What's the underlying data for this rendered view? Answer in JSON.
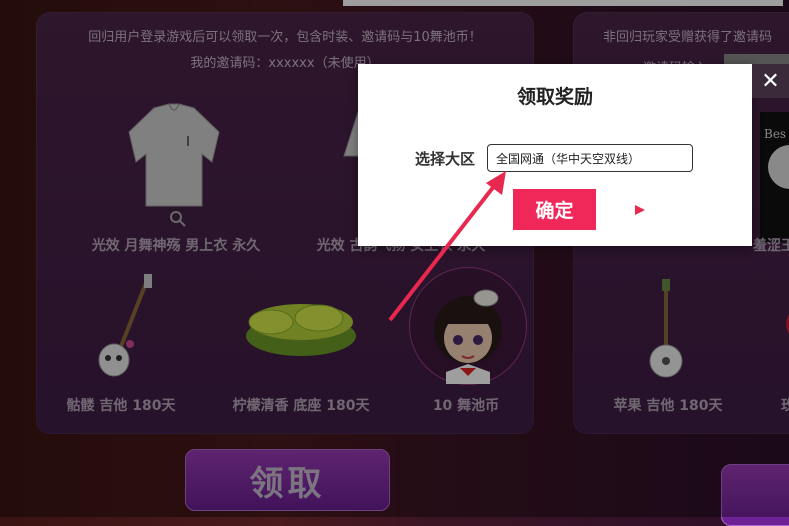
{
  "left_panel": {
    "notice": "回归用户登录游戏后可以领取一次，包含时装、邀请码与10舞池币！",
    "invite_code": "我的邀请码：xxxxxx（未使用）",
    "items": [
      {
        "name": "光效 月舞神殇 男上衣 永久"
      },
      {
        "name": "光效 古韵飞扬 女上衣 永久"
      },
      {
        "name": "骷髅 吉他 180天"
      },
      {
        "name": "柠檬清香 底座 180天"
      },
      {
        "name": "10 舞池币"
      }
    ],
    "claim_label": "领取"
  },
  "right_panel": {
    "notice": "非回归玩家受赠获得了邀请码",
    "sub": "邀请码输入",
    "items": [
      {
        "name": "苹果 吉他 180天"
      },
      {
        "name": "羞涩王"
      },
      {
        "name": "玫"
      }
    ]
  },
  "modal": {
    "title": "领取奖励",
    "region_label": "选择大区",
    "region_value": "全国网通（华中天空双线）",
    "confirm_label": "确定",
    "close_glyph": "✕"
  },
  "colors": {
    "confirm": "#f0285a",
    "arrow": "#e8284e",
    "panel": "#4b2547"
  }
}
